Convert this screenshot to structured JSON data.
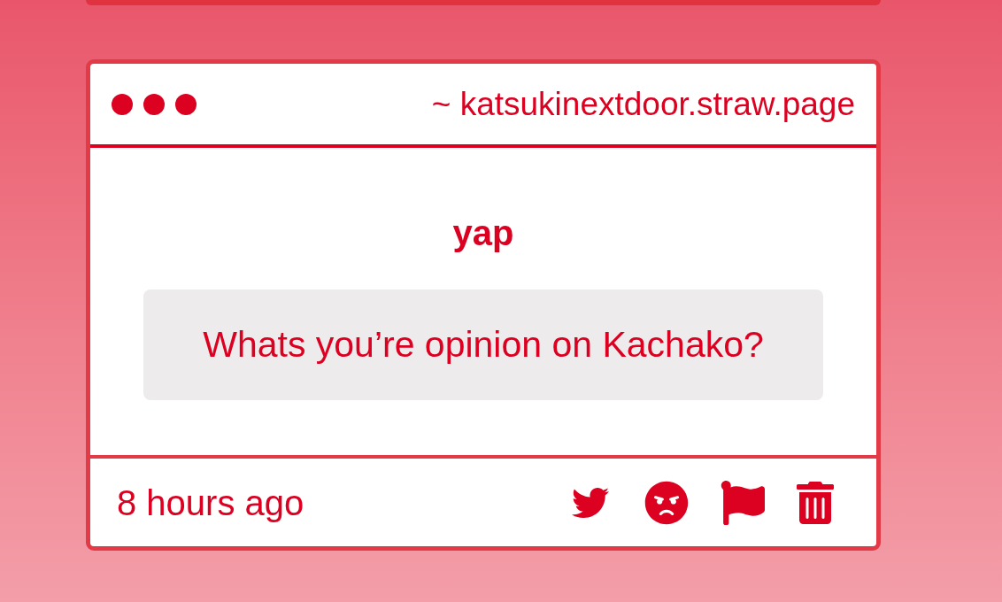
{
  "card": {
    "url": "~ katsukinextdoor.straw.page",
    "title": "yap",
    "question": "Whats you’re opinion on Kachako?",
    "time": "8 hours ago"
  }
}
